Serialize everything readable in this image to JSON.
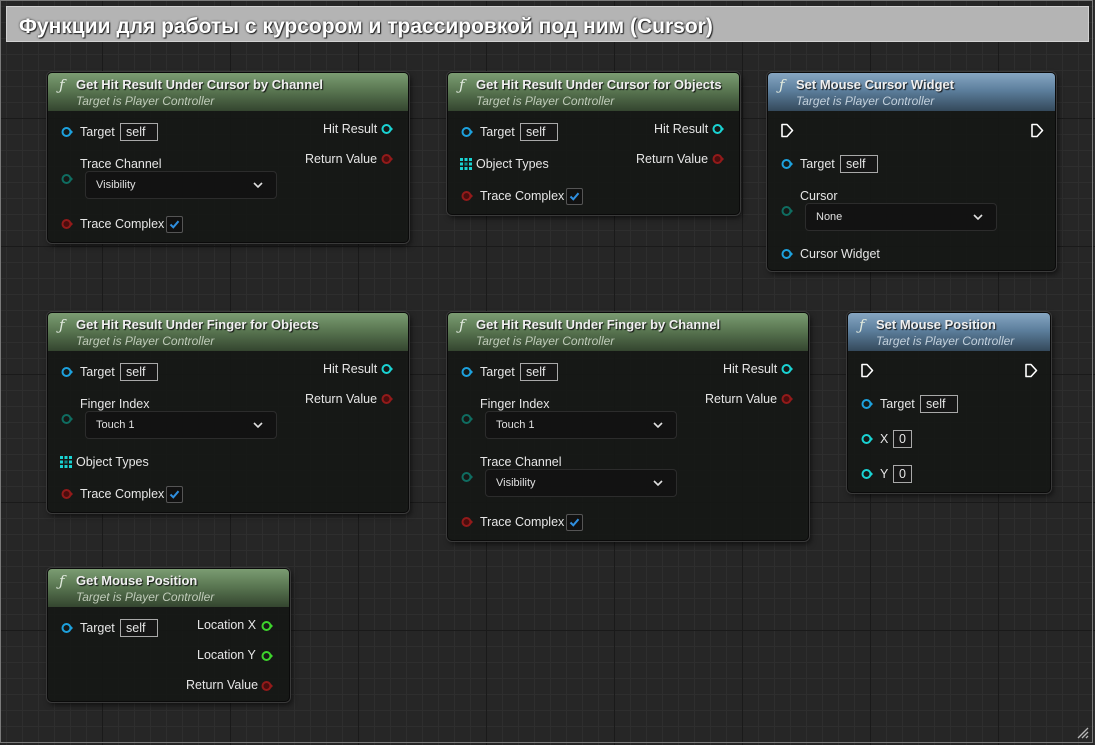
{
  "comment": {
    "title": "Функции для работы с курсором и трассировкой под ним (Cursor)"
  },
  "colors": {
    "object_pin": "#1da1dd",
    "struct_pin": "#1ad3d3",
    "bool_pin": "#931a1a",
    "float_pin": "#3dd42c",
    "byte_pin": "#0f6d61",
    "pure_header": "#6b8d62",
    "impure_header": "#6e8fac"
  },
  "icons": {
    "function": "function-icon",
    "exec": "exec-pin-icon",
    "array": "array-pin-icon",
    "chevron": "chevron-down-icon",
    "checkmark": "checkmark-icon",
    "resize": "resize-grip-icon"
  },
  "nodes": {
    "hit_cursor_channel": {
      "title": "Get Hit Result Under Cursor by Channel",
      "subtitle": "Target is Player Controller",
      "target_label": "Target",
      "target_value": "self",
      "trace_channel_label": "Trace Channel",
      "trace_channel_value": "Visibility",
      "trace_complex_label": "Trace Complex",
      "trace_complex_checked": true,
      "hit_result_label": "Hit Result",
      "return_value_label": "Return Value"
    },
    "hit_cursor_objects": {
      "title": "Get Hit Result Under Cursor for Objects",
      "subtitle": "Target is Player Controller",
      "target_label": "Target",
      "target_value": "self",
      "object_types_label": "Object Types",
      "trace_complex_label": "Trace Complex",
      "trace_complex_checked": true,
      "hit_result_label": "Hit Result",
      "return_value_label": "Return Value"
    },
    "set_cursor_widget": {
      "title": "Set Mouse Cursor Widget",
      "subtitle": "Target is Player Controller",
      "target_label": "Target",
      "target_value": "self",
      "cursor_label": "Cursor",
      "cursor_value": "None",
      "cursor_widget_label": "Cursor Widget"
    },
    "hit_finger_objects": {
      "title": "Get Hit Result Under Finger for Objects",
      "subtitle": "Target is Player Controller",
      "target_label": "Target",
      "target_value": "self",
      "finger_index_label": "Finger Index",
      "finger_index_value": "Touch 1",
      "object_types_label": "Object Types",
      "trace_complex_label": "Trace Complex",
      "trace_complex_checked": true,
      "hit_result_label": "Hit Result",
      "return_value_label": "Return Value"
    },
    "hit_finger_channel": {
      "title": "Get Hit Result Under Finger by Channel",
      "subtitle": "Target is Player Controller",
      "target_label": "Target",
      "target_value": "self",
      "finger_index_label": "Finger Index",
      "finger_index_value": "Touch 1",
      "trace_channel_label": "Trace Channel",
      "trace_channel_value": "Visibility",
      "trace_complex_label": "Trace Complex",
      "trace_complex_checked": true,
      "hit_result_label": "Hit Result",
      "return_value_label": "Return Value"
    },
    "set_mouse_position": {
      "title": "Set Mouse Position",
      "subtitle": "Target is Player Controller",
      "target_label": "Target",
      "target_value": "self",
      "x_label": "X",
      "x_value": "0",
      "y_label": "Y",
      "y_value": "0"
    },
    "get_mouse_position": {
      "title": "Get Mouse Position",
      "subtitle": "Target is Player Controller",
      "target_label": "Target",
      "target_value": "self",
      "location_x_label": "Location X",
      "location_y_label": "Location Y",
      "return_value_label": "Return Value"
    }
  }
}
